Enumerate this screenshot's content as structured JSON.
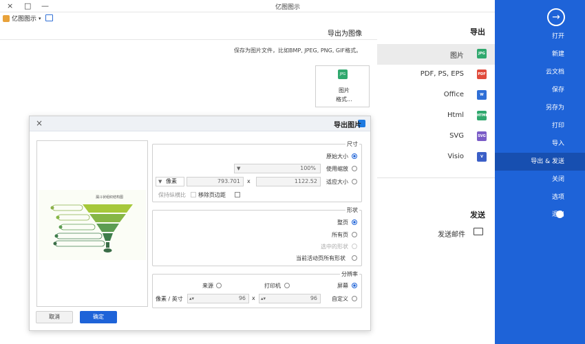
{
  "window": {
    "title": "亿图图示",
    "brand": "亿图图示",
    "controls": [
      "×",
      "□",
      "—"
    ]
  },
  "sidebar": {
    "items": [
      {
        "label": "打开"
      },
      {
        "label": "新建"
      },
      {
        "label": "云文档"
      },
      {
        "label": "保存"
      },
      {
        "label": "另存为"
      },
      {
        "label": "打印"
      },
      {
        "label": "导入"
      },
      {
        "label": "导出 & 发送",
        "active": true
      },
      {
        "label": "关闭"
      },
      {
        "label": "选项"
      },
      {
        "label": "退出"
      }
    ],
    "accent": "#1e63d8"
  },
  "nav": {
    "export_head": "导出",
    "send_head": "发送",
    "items": [
      {
        "label": "图片",
        "icon": "JPG",
        "color": "#2fa86d",
        "active": true
      },
      {
        "label": "PDF, PS, EPS",
        "icon": "PDF",
        "color": "#e04a3b"
      },
      {
        "label": "Office",
        "icon": "W",
        "color": "#2f6fd6"
      },
      {
        "label": "Html",
        "icon": "HTML",
        "color": "#2fa86d"
      },
      {
        "label": "SVG",
        "icon": "SVG",
        "color": "#7a5cc7"
      },
      {
        "label": "Visio",
        "icon": "V",
        "color": "#3b5fc7"
      }
    ],
    "email": "发送邮件"
  },
  "content": {
    "title": "导出为图像",
    "desc": "保存为图片文件，比如BMP, JPEG, PNG, GIF格式。",
    "card_icon": "JPG",
    "card_label1": "图片",
    "card_label2": "格式..."
  },
  "dialog": {
    "title": "导出图片",
    "size_group": "尺寸",
    "opt_original": "原始大小",
    "opt_zoom": "使用缩放",
    "zoom_value": "100%",
    "opt_fit": "适应大小",
    "width": "1122.52",
    "height": "793.701",
    "unit": "像素",
    "times": "x",
    "remove_margin": "移除页边距",
    "keep_ratio": "保持纵横比",
    "shape_group": "形状",
    "opt_page": "整页",
    "opt_all": "所有页",
    "opt_selected": "选中的形状",
    "opt_current": "当前活动页所有形状",
    "res_group": "分辨率",
    "opt_screen": "屏幕",
    "opt_printer": "打印机",
    "opt_source": "来源",
    "opt_custom": "自定义",
    "dpi_x": "96",
    "dpi_y": "96",
    "dpi_unit": "像素 / 英寸",
    "ok": "确定",
    "cancel": "取消",
    "preview_title": "漏斗状组织结构图"
  }
}
